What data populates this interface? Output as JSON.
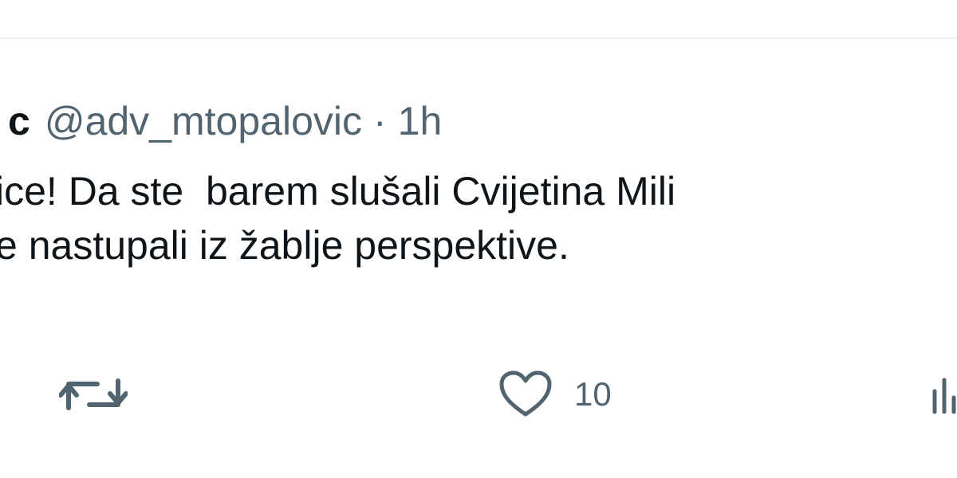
{
  "tweet": {
    "author_name_visible": "c",
    "author_handle": "@adv_mtopalovic",
    "separator": "·",
    "timestamp": "1h",
    "text_lines": [
      "ice! Da ste  barem slušali Cvijetina Mili",
      "e nastupali iz žablje perspektive."
    ]
  },
  "actions": {
    "retweet_icon": "retweet-icon",
    "like_icon": "heart-icon",
    "like_count": "10",
    "analytics_icon": "analytics-icon"
  },
  "colors": {
    "text_primary": "#0f1419",
    "text_secondary": "#536471",
    "divider": "#eef1f3",
    "background": "#ffffff"
  }
}
